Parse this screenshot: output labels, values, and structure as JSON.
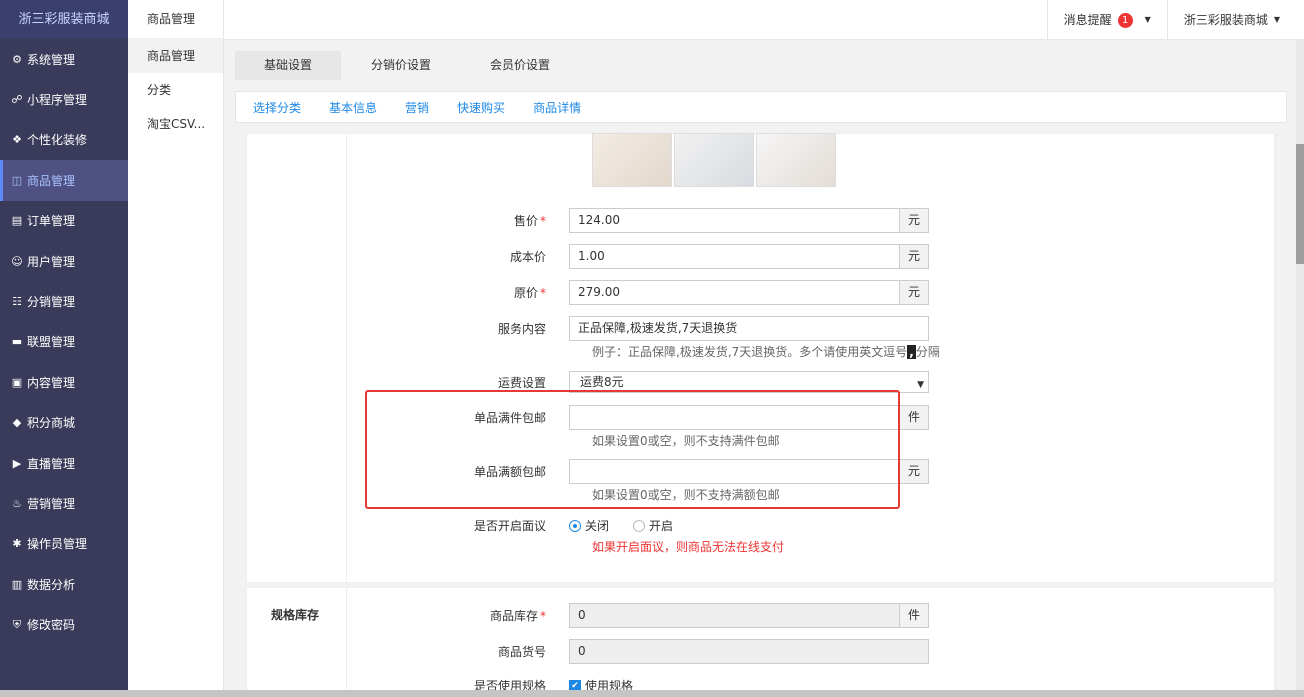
{
  "brand": "浙三彩服装商城",
  "nav": [
    {
      "label": "系统管理",
      "icon": "gear-icon",
      "glyph": "⚙",
      "active": false
    },
    {
      "label": "小程序管理",
      "icon": "link-icon",
      "glyph": "☍",
      "active": false
    },
    {
      "label": "个性化装修",
      "icon": "diamond-icon",
      "glyph": "❖",
      "active": false
    },
    {
      "label": "商品管理",
      "icon": "bag-icon",
      "glyph": "◫",
      "active": true
    },
    {
      "label": "订单管理",
      "icon": "list-icon",
      "glyph": "▤",
      "active": false
    },
    {
      "label": "用户管理",
      "icon": "user-icon",
      "glyph": "☺",
      "active": false
    },
    {
      "label": "分销管理",
      "icon": "network-icon",
      "glyph": "☷",
      "active": false
    },
    {
      "label": "联盟管理",
      "icon": "card-icon",
      "glyph": "▬",
      "active": false
    },
    {
      "label": "内容管理",
      "icon": "content-icon",
      "glyph": "▣",
      "active": false
    },
    {
      "label": "积分商城",
      "icon": "box-icon",
      "glyph": "◆",
      "active": false
    },
    {
      "label": "直播管理",
      "icon": "play-icon",
      "glyph": "▶",
      "active": false
    },
    {
      "label": "营销管理",
      "icon": "marketing-icon",
      "glyph": "♨",
      "active": false
    },
    {
      "label": "操作员管理",
      "icon": "cog-icon",
      "glyph": "✱",
      "active": false
    },
    {
      "label": "数据分析",
      "icon": "chart-icon",
      "glyph": "▥",
      "active": false
    },
    {
      "label": "修改密码",
      "icon": "shield-icon",
      "glyph": "⛨",
      "active": false
    }
  ],
  "subnav": {
    "title": "商品管理",
    "items": [
      {
        "label": "商品管理",
        "active": true
      },
      {
        "label": "分类",
        "active": false
      },
      {
        "label": "淘宝CSV...",
        "active": false
      }
    ]
  },
  "topbar": {
    "messages_label": "消息提醒",
    "messages_count": "1",
    "store_label": "浙三彩服装商城"
  },
  "tabs": [
    "基础设置",
    "分销价设置",
    "会员价设置"
  ],
  "subtabs": [
    "选择分类",
    "基本信息",
    "营销",
    "快速购买",
    "商品详情"
  ],
  "form": {
    "price": {
      "label": "售价",
      "value": "124.00",
      "unit": "元"
    },
    "cost": {
      "label": "成本价",
      "value": "1.00",
      "unit": "元"
    },
    "original": {
      "label": "原价",
      "value": "279.00",
      "unit": "元"
    },
    "service": {
      "label": "服务内容",
      "value": "正品保障,极速发货,7天退换货",
      "help_prefix": "例子：正品保障,极速发货,7天退换货。多个请使用英文逗号",
      "help_comma": ",",
      "help_suffix": "分隔"
    },
    "shipping": {
      "label": "运费设置",
      "value": "运费8元"
    },
    "free_pieces": {
      "label": "单品满件包邮",
      "value": "",
      "unit": "件",
      "help": "如果设置0或空，则不支持满件包邮"
    },
    "free_amount": {
      "label": "单品满额包邮",
      "value": "",
      "unit": "元",
      "help": "如果设置0或空，则不支持满额包邮"
    },
    "negotiable": {
      "label": "是否开启面议",
      "off": "关闭",
      "on": "开启",
      "help": "如果开启面议，则商品无法在线支付"
    }
  },
  "stock": {
    "section": "规格库存",
    "inventory": {
      "label": "商品库存",
      "value": "0",
      "unit": "件"
    },
    "sku": {
      "label": "商品货号",
      "value": "0"
    },
    "use_spec": {
      "label": "是否使用规格",
      "option": "使用规格"
    }
  }
}
